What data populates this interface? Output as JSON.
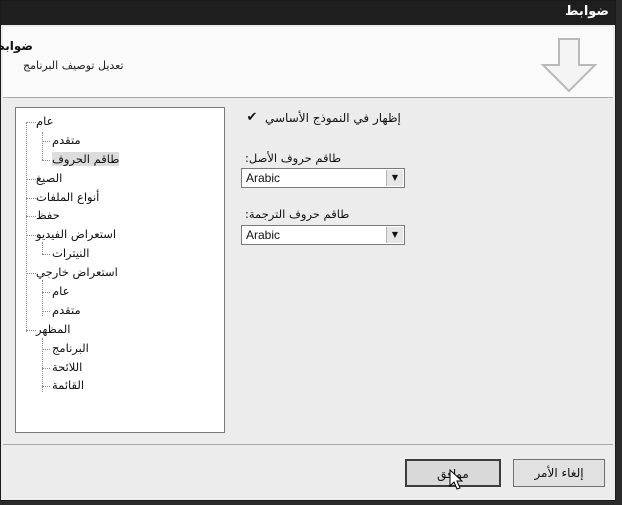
{
  "window": {
    "title": "ضوابط"
  },
  "header": {
    "title": "ضوابط",
    "subtitle": "تعديل توصيف البرنامج",
    "icon": "down-arrow-icon"
  },
  "tree": {
    "items": [
      {
        "label": "عام",
        "level": 0
      },
      {
        "label": "متقدم",
        "level": 1
      },
      {
        "label": "طاقم الحروف",
        "level": 1,
        "selected": true
      },
      {
        "label": "الصيغ",
        "level": 0
      },
      {
        "label": "أنواع الملفات",
        "level": 0
      },
      {
        "label": "حفظ",
        "level": 0
      },
      {
        "label": "استعراض الفيديو",
        "level": 0
      },
      {
        "label": "النيترات",
        "level": 1
      },
      {
        "label": "استعراض خارجي",
        "level": 0
      },
      {
        "label": "عام",
        "level": 1
      },
      {
        "label": "متقدم",
        "level": 1
      },
      {
        "label": "المظهر",
        "level": 0
      },
      {
        "label": "البرنامج",
        "level": 1
      },
      {
        "label": "اللائحة",
        "level": 1
      },
      {
        "label": "القائمة",
        "level": 1
      }
    ]
  },
  "options": {
    "show_in_base_model": {
      "label": "إظهار في النموذج الأساسي",
      "checked": true,
      "glyph": "✔"
    },
    "source_charset": {
      "label": "طاقم حروف الأصل:",
      "value": "Arabic"
    },
    "target_charset": {
      "label": "طاقم حروف الترجمة:",
      "value": "Arabic"
    }
  },
  "buttons": {
    "ok": "موافق",
    "cancel": "إلغاء الأمر"
  }
}
